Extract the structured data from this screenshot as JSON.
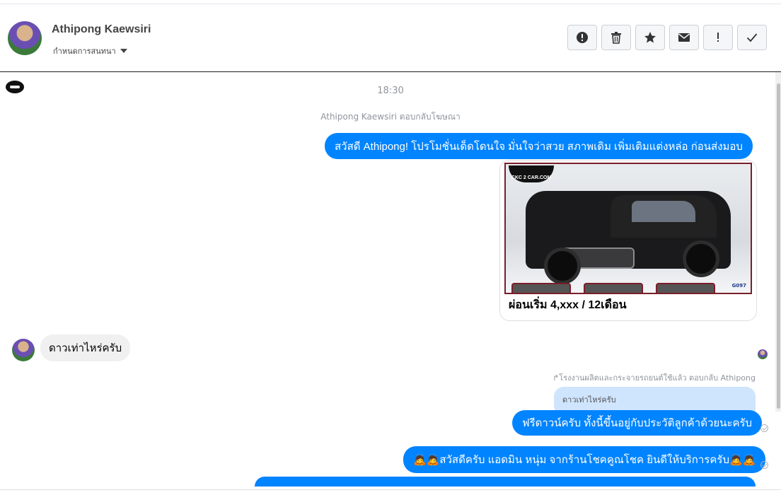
{
  "header": {
    "contact_name": "Athipong Kaewsiri",
    "conversation_label": "กำหนดการสนทนา",
    "actions": [
      {
        "name": "spam-button",
        "icon": "alert-circle-icon"
      },
      {
        "name": "delete-button",
        "icon": "trash-icon"
      },
      {
        "name": "star-button",
        "icon": "star-icon"
      },
      {
        "name": "mark-unread-button",
        "icon": "envelope-icon"
      },
      {
        "name": "important-button",
        "icon": "exclamation-icon"
      },
      {
        "name": "done-button",
        "icon": "check-icon"
      }
    ]
  },
  "chat": {
    "timestamp": "18:30",
    "ad_reply_notice": "Athipong Kaewsiri ตอบกลับโฆษณา",
    "messages": {
      "greeting": "สวัสดี Athipong! โปรโมชั่นเด็ดโดนใจ มั่นใจว่าสวย สภาพเดิม เพิ่มเติมแต่งหล่อ ก่อนส่งมอบ",
      "card_title": "ผ่อนเริ่ม 4,xxx / 12เดือน",
      "card_logo": "CKC 2 CAR.COM",
      "card_code": "G097",
      "incoming": "ดาวเท่าไหร่ครับ",
      "reply_meta": "↱โรงงานผลิตและกระจายรถยนต์ใช้แล้ว ตอบกลับ Athipong",
      "quoted": "ดาวเท่าไหร่ครับ",
      "answer": "ฟรีดาวน์ครับ ทั้งนี้ขึ้นอยู่กับประวัติลูกค้าด้วยนะครับ",
      "welcome": "🙇🙇สวัสดีครับ แอดมิน หนุ่ม จากร้านโชคคูณโชค ยินดีให้บริการครับ🙇🙇"
    }
  },
  "colors": {
    "outgoing_bubble": "#0084ff",
    "incoming_bubble": "#f1f0f0",
    "quoted_bubble": "#cfe4fd"
  }
}
